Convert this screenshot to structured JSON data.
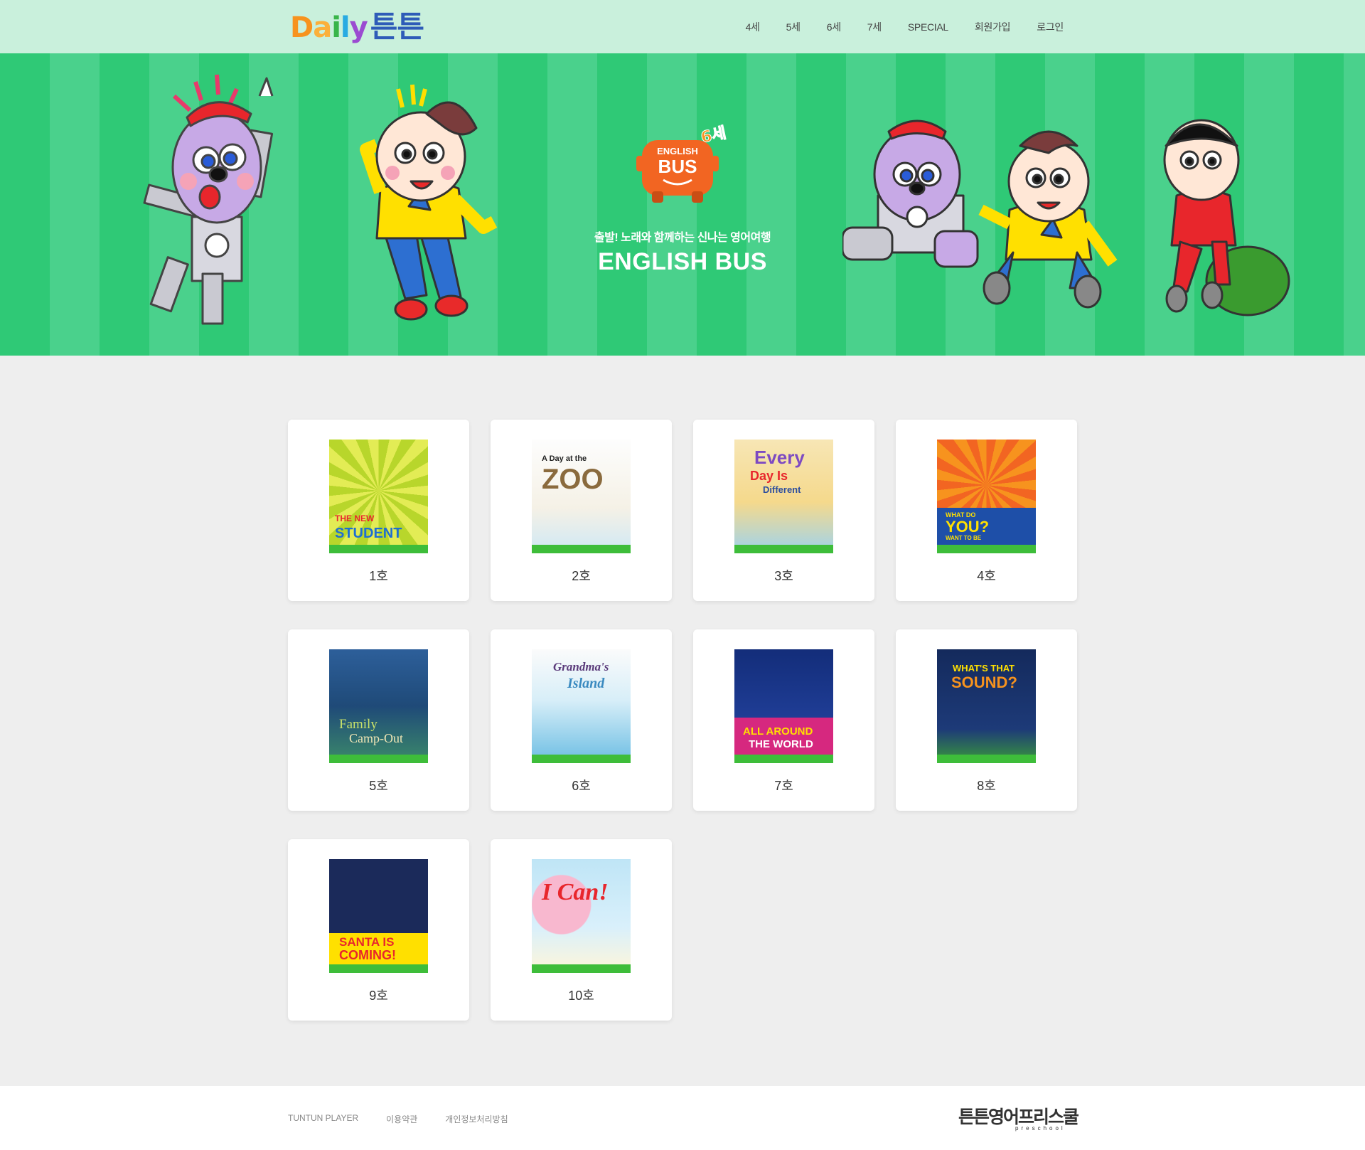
{
  "header": {
    "logo": {
      "latin": [
        "D",
        "a",
        "i",
        "l",
        "y"
      ],
      "korean": "튼튼"
    },
    "nav": [
      "4세",
      "5세",
      "6세",
      "7세",
      "SPECIAL",
      "회원가입",
      "로그인"
    ]
  },
  "hero": {
    "bus_logo": {
      "line1": "ENGLISH",
      "line2": "BUS",
      "age": "6세"
    },
    "subtitle": "출발! 노래와 함께하는 신나는 영어여행",
    "title": "ENGLISH BUS"
  },
  "issues": [
    {
      "label": "1호",
      "cover_text": [
        "THE NEW",
        "STUDENT"
      ],
      "cover_num": "1"
    },
    {
      "label": "2호",
      "cover_text": [
        "A Day at the",
        "ZOO"
      ],
      "cover_num": "2"
    },
    {
      "label": "3호",
      "cover_text": [
        "Every",
        "Day Is",
        "Different"
      ],
      "cover_num": "3"
    },
    {
      "label": "4호",
      "cover_text": [
        "WHAT DO",
        "YOU?",
        "WANT TO BE"
      ],
      "cover_num": "4"
    },
    {
      "label": "5호",
      "cover_text": [
        "Family",
        "Camp-Out"
      ],
      "cover_num": "5"
    },
    {
      "label": "6호",
      "cover_text": [
        "Grandma's",
        "Island"
      ],
      "cover_num": "6"
    },
    {
      "label": "7호",
      "cover_text": [
        "ALL AROUND",
        "THE WORLD"
      ],
      "cover_num": "7"
    },
    {
      "label": "8호",
      "cover_text": [
        "WHAT'S THAT",
        "SOUND?"
      ],
      "cover_num": "8"
    },
    {
      "label": "9호",
      "cover_text": [
        "SANTA IS",
        "COMING!"
      ],
      "cover_num": "9"
    },
    {
      "label": "10호",
      "cover_text": [
        "I Can!"
      ],
      "cover_num": "10"
    }
  ],
  "footer": {
    "links": [
      "TUNTUN PLAYER",
      "이용약관",
      "개인정보처리방침"
    ],
    "logo_ko": "튼튼영어프리스쿨",
    "logo_en": "preschool"
  },
  "colors": {
    "header_bg": "#c9f0dc",
    "hero_stripe_a": "#2fc976",
    "hero_stripe_b": "#4ad18c",
    "page_bg": "#eeeeee",
    "bus_orange": "#f26522"
  }
}
